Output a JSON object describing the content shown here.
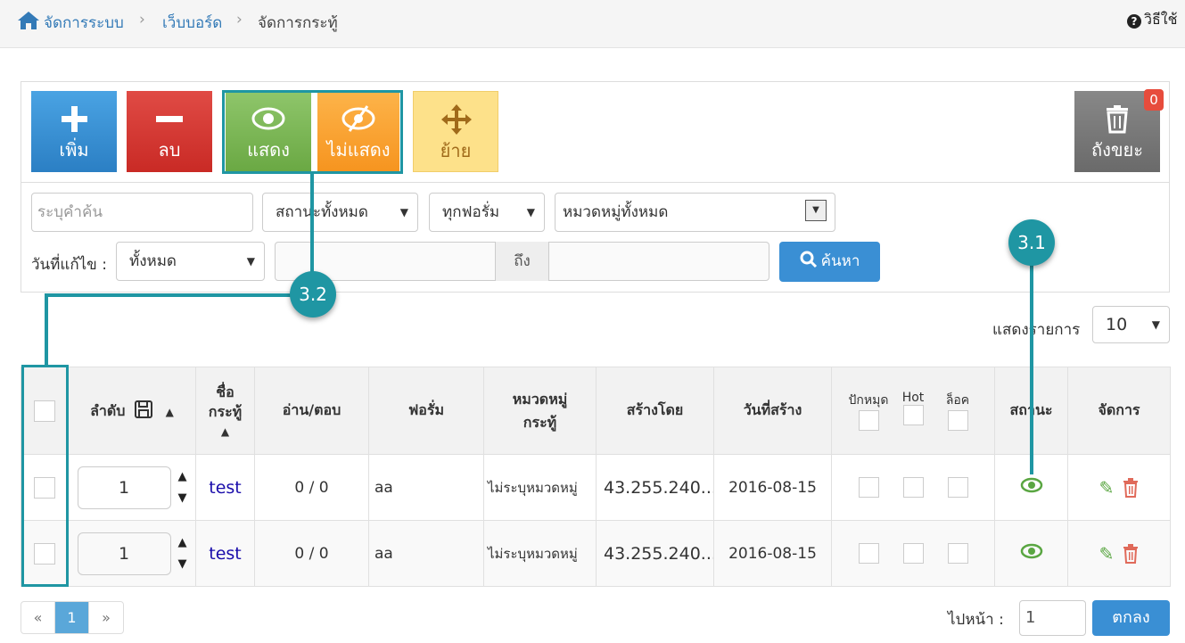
{
  "breadcrumb": {
    "home": "จัดการระบบ",
    "section": "เว็บบอร์ด",
    "current": "จัดการกระทู้"
  },
  "help": {
    "label": "วิธีใช้"
  },
  "toolbar": {
    "add": "เพิ่ม",
    "delete": "ลบ",
    "show": "แสดง",
    "hide": "ไม่แสดง",
    "move": "ย้าย",
    "trash": "ถังขยะ",
    "trash_count": "0"
  },
  "filters": {
    "keyword_placeholder": "ระบุคำค้น",
    "status": "สถานะทั้งหมด",
    "forum": "ทุกฟอรั่ม",
    "category": "หมวดหมู่ทั้งหมด",
    "date_label": "วันที่แก้ไข :",
    "date_value": "ทั้งหมด",
    "range_to": "ถึง",
    "search": "ค้นหา"
  },
  "callouts": {
    "c31": "3.1",
    "c32": "3.2"
  },
  "list": {
    "per_page_label": "แสดงรายการ",
    "per_page": "10",
    "headers": {
      "order": "ลำดับ",
      "title": "ชื่อ กระทู้",
      "read_reply": "อ่าน/ตอบ",
      "forum": "ฟอรั่ม",
      "category": "หมวดหมู่ กระทู้",
      "created_by": "สร้างโดย",
      "created_date": "วันที่สร้าง",
      "pin": "ปักหมุด",
      "hot": "Hot",
      "lock": "ล็อค",
      "status": "สถานะ",
      "manage": "จัดการ"
    },
    "rows": [
      {
        "order": "1",
        "title": "test",
        "read_reply": "0 / 0",
        "forum": "aa",
        "category": "ไม่ระบุหมวดหมู่",
        "created_by": "43.255.240....",
        "created_date": "2016-08-15"
      },
      {
        "order": "1",
        "title": "test",
        "read_reply": "0 / 0",
        "forum": "aa",
        "category": "ไม่ระบุหมวดหมู่",
        "created_by": "43.255.240....",
        "created_date": "2016-08-15"
      }
    ]
  },
  "pagination": {
    "prev": "«",
    "current": "1",
    "next": "»",
    "goto_label": "ไปหน้า  :",
    "goto_value": "1",
    "go": "ตกลง"
  },
  "colors": {
    "accent": "#1f96a3",
    "primary": "#3a8fd4",
    "success": "#6aa843",
    "danger": "#c92a25",
    "warning": "#f6941f"
  }
}
